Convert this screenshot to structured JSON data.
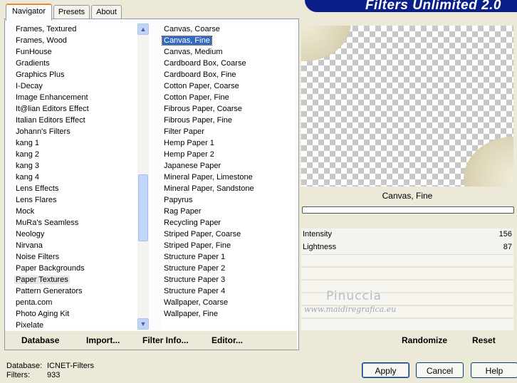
{
  "app": {
    "title": "Filters Unlimited 2.0"
  },
  "tabs": [
    {
      "label": "Navigator"
    },
    {
      "label": "Presets"
    },
    {
      "label": "About"
    }
  ],
  "categories": {
    "selected": "Paper Textures",
    "items": [
      "Frames, Textured",
      "Frames, Wood",
      "FunHouse",
      "Gradients",
      "Graphics Plus",
      "I-Decay",
      "Image Enhancement",
      "It@lian Editors Effect",
      "Italian Editors Effect",
      "Johann's Filters",
      "kang 1",
      "kang 2",
      "kang 3",
      "kang 4",
      "Lens Effects",
      "Lens Flares",
      "Mock",
      "MuRa's Seamless",
      "Neology",
      "Nirvana",
      "Noise Filters",
      "Paper Backgrounds",
      "Paper Textures",
      "Pattern Generators",
      "penta.com",
      "Photo Aging Kit",
      "Pixelate"
    ]
  },
  "filters": {
    "selected": "Canvas, Fine",
    "items": [
      "Canvas, Coarse",
      "Canvas, Fine",
      "Canvas, Medium",
      "Cardboard Box, Coarse",
      "Cardboard Box, Fine",
      "Cotton Paper, Coarse",
      "Cotton Paper, Fine",
      "Fibrous Paper, Coarse",
      "Fibrous Paper, Fine",
      "Filter Paper",
      "Hemp Paper 1",
      "Hemp Paper 2",
      "Japanese Paper",
      "Mineral Paper, Limestone",
      "Mineral Paper, Sandstone",
      "Papyrus",
      "Rag Paper",
      "Recycling Paper",
      "Striped Paper, Coarse",
      "Striped Paper, Fine",
      "Structure Paper 1",
      "Structure Paper 2",
      "Structure Paper 3",
      "Structure Paper 4",
      "Wallpaper, Coarse",
      "Wallpaper, Fine"
    ]
  },
  "left_bar": {
    "database": "Database",
    "import": "Import...",
    "filter_info": "Filter Info...",
    "editor": "Editor..."
  },
  "preview": {
    "filter_name": "Canvas, Fine",
    "progress": 0,
    "sliders": [
      {
        "label": "Intensity",
        "value": "156"
      },
      {
        "label": "Lightness",
        "value": "87"
      }
    ],
    "watermark_name": "Pinuccia",
    "watermark_url": "www.maidiregrafica.eu"
  },
  "right_bar": {
    "randomize": "Randomize",
    "reset": "Reset"
  },
  "status": {
    "database_label": "Database:",
    "database_value": "ICNET-Filters",
    "filters_label": "Filters:",
    "filters_value": "933"
  },
  "buttons": {
    "apply": "Apply",
    "cancel": "Cancel",
    "help": "Help"
  },
  "colors": {
    "banner": "#0b1f8a",
    "selection": "#316ac5",
    "window": "#ece9d8"
  }
}
